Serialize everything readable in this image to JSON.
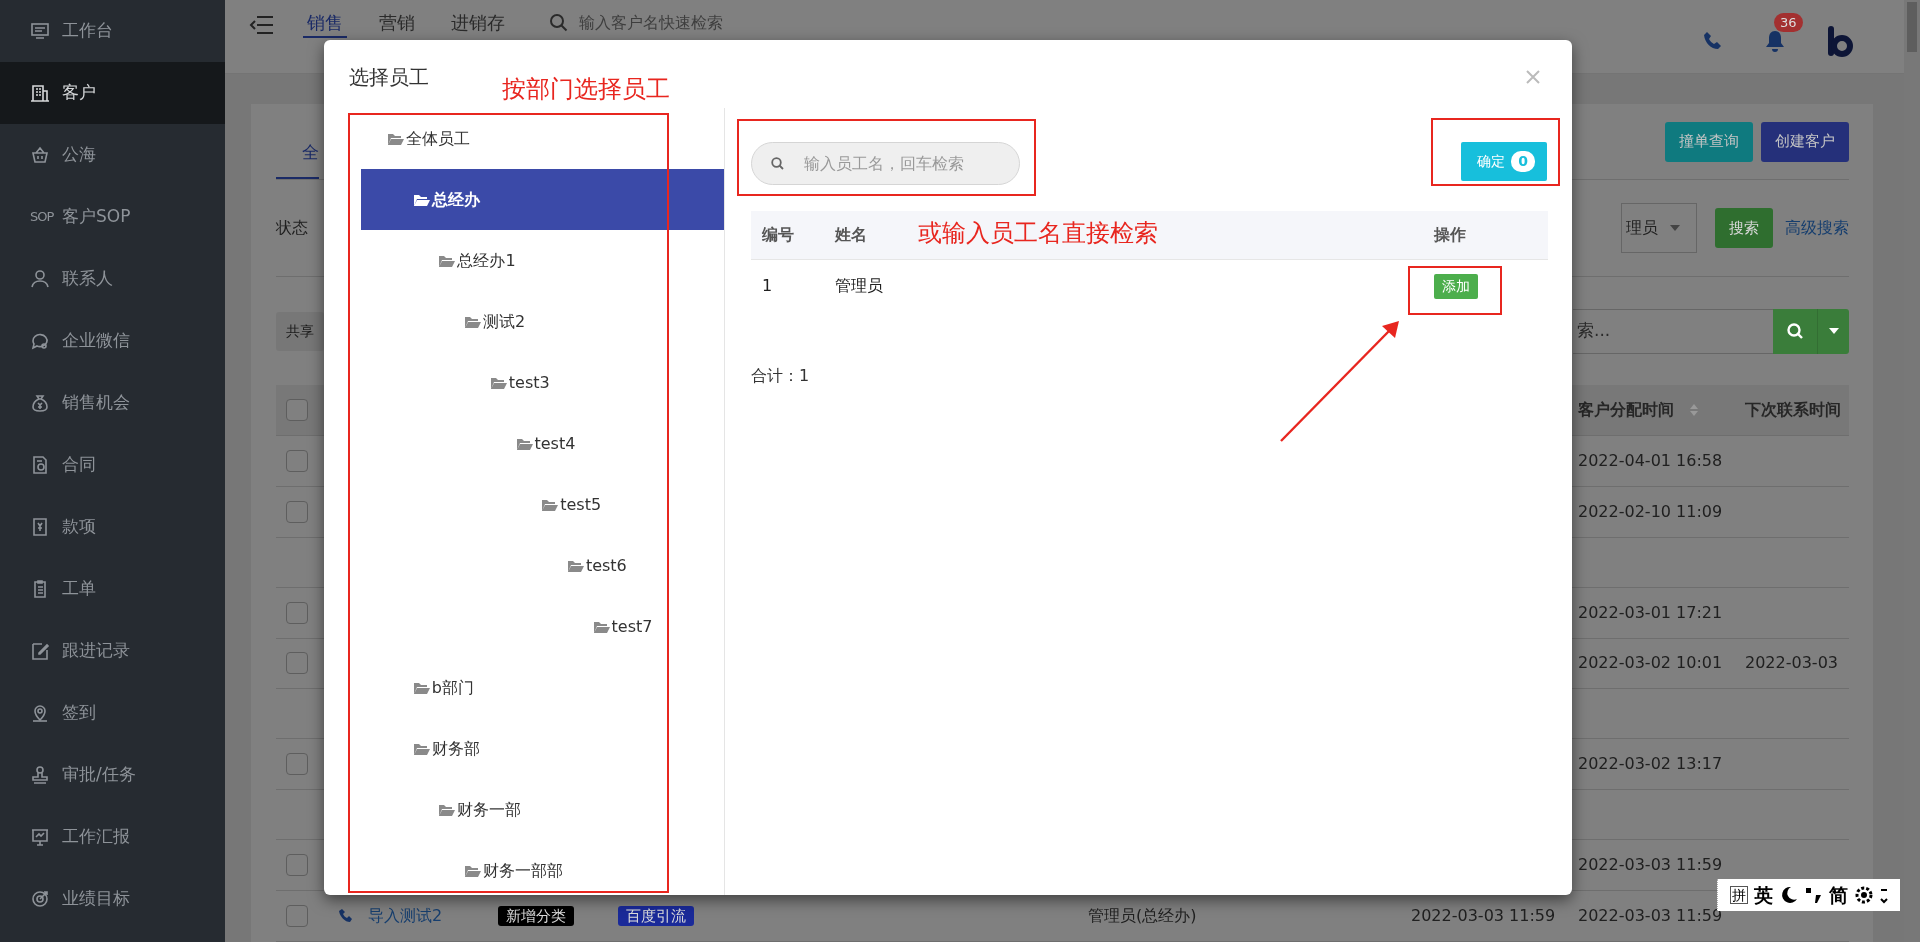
{
  "sidebar": {
    "items": [
      {
        "label": "工作台",
        "selected": false
      },
      {
        "label": "客户",
        "selected": true
      },
      {
        "label": "公海",
        "selected": false
      },
      {
        "label": "客户SOP",
        "icon_text": "SOP",
        "selected": false
      },
      {
        "label": "联系人",
        "selected": false
      },
      {
        "label": "企业微信",
        "selected": false
      },
      {
        "label": "销售机会",
        "selected": false
      },
      {
        "label": "合同",
        "selected": false
      },
      {
        "label": "款项",
        "selected": false
      },
      {
        "label": "工单",
        "selected": false
      },
      {
        "label": "跟进记录",
        "selected": false
      },
      {
        "label": "签到",
        "selected": false
      },
      {
        "label": "审批/任务",
        "selected": false
      },
      {
        "label": "工作汇报",
        "selected": false
      },
      {
        "label": "业绩目标",
        "selected": false
      }
    ]
  },
  "topbar": {
    "tabs": [
      {
        "label": "销售",
        "selected": true
      },
      {
        "label": "营销",
        "selected": false
      },
      {
        "label": "进销存",
        "selected": false
      }
    ],
    "search": {
      "placeholder": "输入客户名快速检索"
    },
    "notification_count": "36"
  },
  "page": {
    "tabs": [
      {
        "label": "全",
        "selected": true
      }
    ],
    "buttons": [
      {
        "label": "撞单查询",
        "color": "#0f7a7f"
      },
      {
        "label": "创建客户",
        "color": "#25307a"
      }
    ],
    "filter": {
      "label": "状态",
      "owner_select": "理员",
      "search_button": "搜索",
      "advanced_link": "高级搜索"
    },
    "share_button": "共享",
    "quick_search": {
      "placeholder": "索..."
    },
    "table": {
      "columns": [
        {
          "label": "客户分配时间",
          "sortable": true
        },
        {
          "label": "下次联系时间",
          "sortable": false
        }
      ],
      "select_all_checked": false,
      "rows": [
        {
          "kind": "record",
          "checked": false,
          "assigned": "2022-04-01 16:58"
        },
        {
          "kind": "record",
          "checked": false,
          "assigned": "2022-02-10 11:09"
        },
        {
          "kind": "spacer"
        },
        {
          "kind": "record",
          "checked": false,
          "assigned": "2022-03-01 17:21"
        },
        {
          "kind": "record",
          "checked": false,
          "assigned": "2022-03-02 10:01",
          "next_contact": "2022-03-03"
        },
        {
          "kind": "spacer"
        },
        {
          "kind": "record",
          "checked": false,
          "assigned": "2022-03-02 13:17"
        },
        {
          "kind": "spacer"
        },
        {
          "kind": "record",
          "checked": false,
          "assigned": "2022-03-03 11:59"
        },
        {
          "kind": "record",
          "checked": false,
          "name": "导入测试2",
          "tags": [
            {
              "label": "新增分类",
              "color": "#000000"
            },
            {
              "label": "百度引流",
              "color": "#1a2a99"
            }
          ],
          "owner": "管理员(总经办)",
          "created": "2022-03-03 11:59",
          "assigned": "2022-03-03 11:59"
        }
      ]
    }
  },
  "dialog": {
    "title": "选择员工",
    "tree": [
      {
        "label": "全体员工",
        "selected": false,
        "children": [
          {
            "label": "总经办",
            "selected": true,
            "children": [
              {
                "label": "总经办1",
                "selected": false,
                "children": [
                  {
                    "label": "测试2",
                    "selected": false,
                    "children": [
                      {
                        "label": "test3",
                        "selected": false,
                        "children": [
                          {
                            "label": "test4",
                            "selected": false,
                            "children": [
                              {
                                "label": "test5",
                                "selected": false,
                                "children": [
                                  {
                                    "label": "test6",
                                    "selected": false,
                                    "children": [
                                      {
                                        "label": "test7",
                                        "selected": false
                                      }
                                    ]
                                  }
                                ]
                              }
                            ]
                          }
                        ]
                      }
                    ]
                  }
                ]
              }
            ]
          },
          {
            "label": "b部门",
            "selected": false
          },
          {
            "label": "财务部",
            "selected": false,
            "children": [
              {
                "label": "财务一部",
                "selected": false,
                "children": [
                  {
                    "label": "财务一部部",
                    "selected": false
                  }
                ]
              }
            ]
          }
        ]
      }
    ],
    "search": {
      "placeholder": "输入员工名，回车检索"
    },
    "confirm": {
      "label": "确定",
      "count": "0"
    },
    "table": {
      "columns": [
        "编号",
        "姓名",
        "操作"
      ],
      "rows": [
        {
          "id": "1",
          "name": "管理员",
          "action": "添加"
        }
      ]
    },
    "total": "合计：1"
  },
  "annotations": [
    {
      "text": "按部门选择员工"
    },
    {
      "text": "或输入员工名直接检索"
    }
  ],
  "ime_toolbar": {
    "items": [
      "拼",
      "英",
      "简"
    ]
  }
}
